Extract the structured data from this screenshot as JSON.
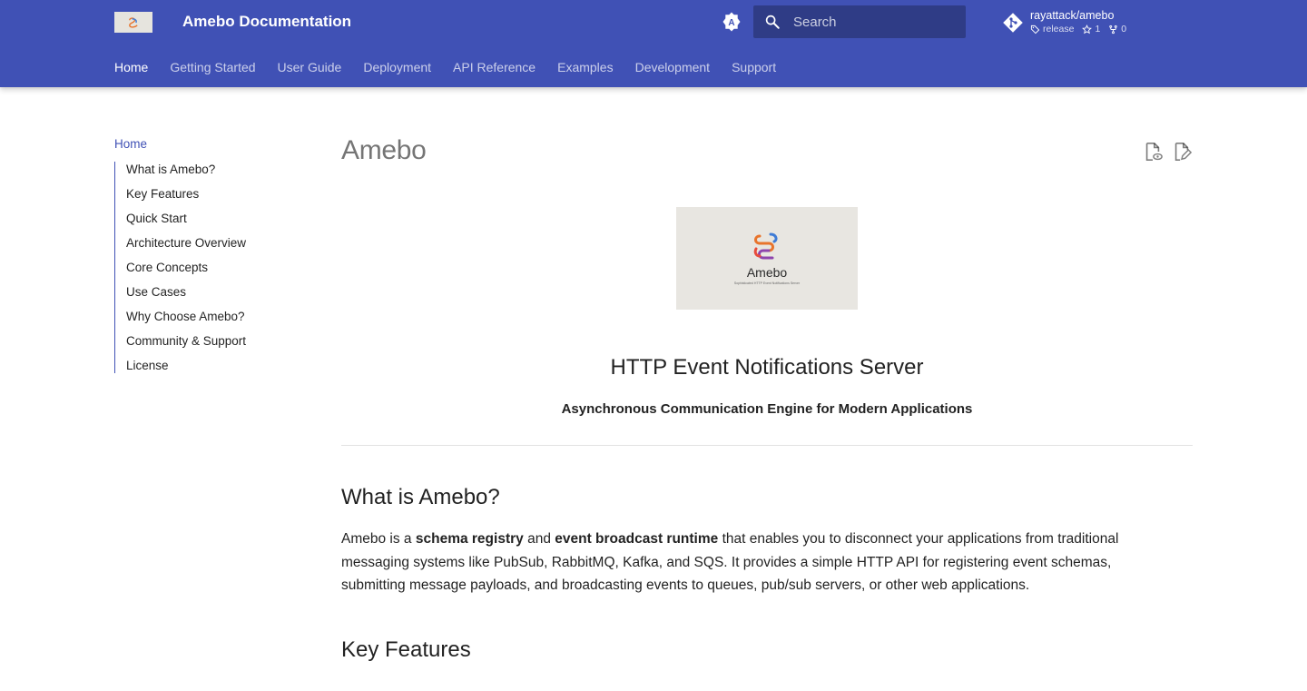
{
  "header": {
    "site_title": "Amebo Documentation",
    "search_placeholder": "Search",
    "palette_icon": "brightness-auto-icon",
    "repo": {
      "name": "rayattack/amebo",
      "tag": "release",
      "stars": "1",
      "forks": "0"
    }
  },
  "tabs": [
    {
      "label": "Home",
      "active": true
    },
    {
      "label": "Getting Started"
    },
    {
      "label": "User Guide"
    },
    {
      "label": "Deployment"
    },
    {
      "label": "API Reference"
    },
    {
      "label": "Examples"
    },
    {
      "label": "Development"
    },
    {
      "label": "Support"
    }
  ],
  "sidebar": {
    "home": "Home",
    "items": [
      "What is Amebo?",
      "Key Features",
      "Quick Start",
      "Architecture Overview",
      "Core Concepts",
      "Use Cases",
      "Why Choose Amebo?",
      "Community & Support",
      "License"
    ]
  },
  "content": {
    "title": "Amebo",
    "hero_image": {
      "brand_name": "Amebo",
      "brand_tagline": "Sophisticated HTTP Event Notifications Server"
    },
    "subtitle": "HTTP Event Notifications Server",
    "tagline": "Asynchronous Communication Engine for Modern Applications",
    "section1_heading": "What is Amebo?",
    "section1_para": {
      "p1": "Amebo is a ",
      "b1": "schema registry",
      "p2": " and ",
      "b2": "event broadcast runtime",
      "p3": " that enables you to disconnect your applications from traditional messaging systems like PubSub, RabbitMQ, Kafka, and SQS. It provides a simple HTTP API for registering event schemas, submitting message payloads, and broadcasting events to queues, pub/sub servers, or other web applications."
    },
    "section2_heading": "Key Features"
  },
  "colors": {
    "primary": "#4051b5",
    "header_text": "#ffffff"
  }
}
